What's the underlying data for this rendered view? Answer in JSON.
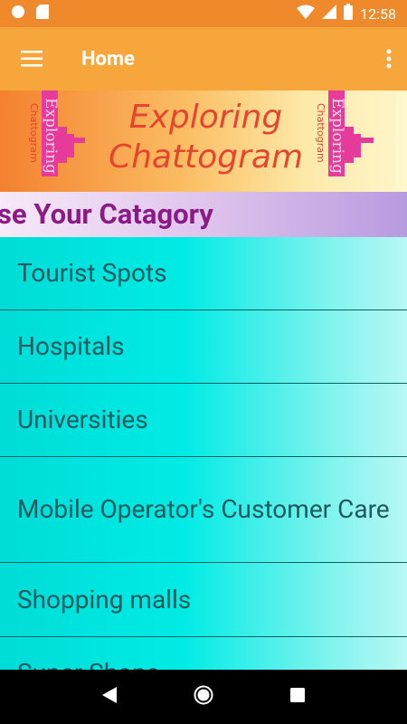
{
  "status_bar": {
    "time": "12:58",
    "icons": [
      "circle-icon",
      "sd-card-icon",
      "wifi-icon",
      "signal-icon",
      "battery-icon"
    ]
  },
  "app_bar": {
    "title": "Home",
    "menu_icon": "hamburger-menu-icon",
    "overflow_icon": "more-vert-icon"
  },
  "banner": {
    "title": "Exploring Chattogram",
    "logo_text_1": "Exploring",
    "logo_text_2": "Chattogram"
  },
  "category_header": {
    "label": "oose Your Catagory"
  },
  "categories": [
    "Tourist Spots",
    "Hospitals",
    "Universities",
    "Mobile Operator's Customer Care",
    "Shopping malls",
    "Super Shops"
  ],
  "colors": {
    "status_bar": "#ee8a2c",
    "app_bar": "#f7a63b",
    "banner_title": "#e5452e",
    "logo_pink": "#e63b9a",
    "category_text": "#8b1a86",
    "list_text": "#1e5a5e"
  }
}
